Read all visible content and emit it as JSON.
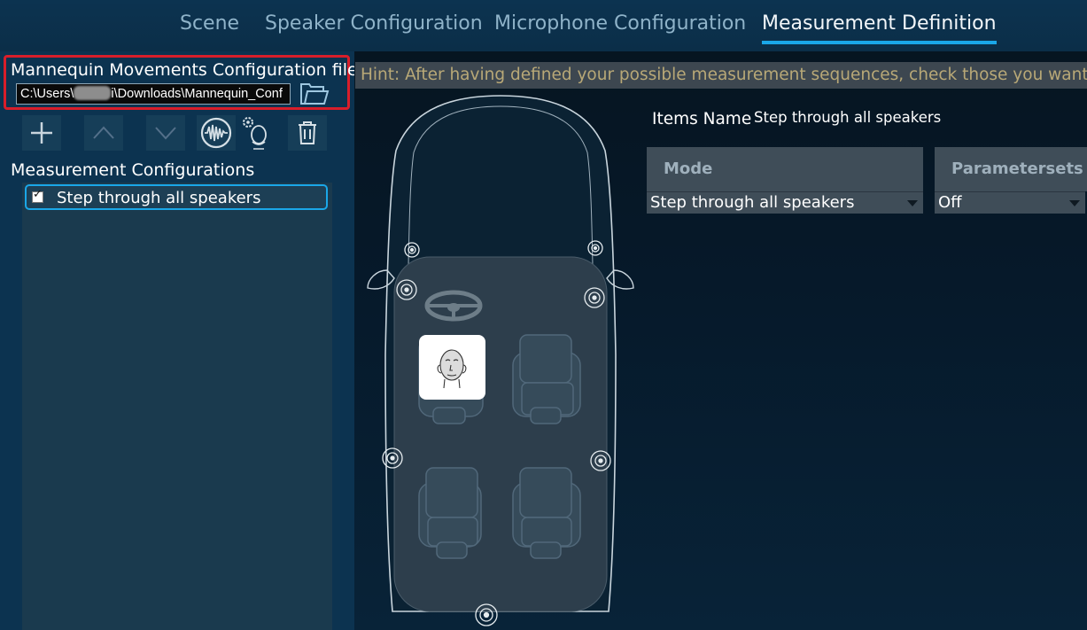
{
  "tabs": [
    {
      "label": "Scene",
      "active": false
    },
    {
      "label": "Speaker Configuration",
      "active": false
    },
    {
      "label": "Microphone Configuration",
      "active": false
    },
    {
      "label": "Measurement Definition",
      "active": true
    }
  ],
  "file": {
    "label": "Mannequin Movements Configuration file :",
    "path_prefix": "C:\\Users\\",
    "path_suffix": "i\\Downloads\\Mannequin_Conf"
  },
  "toolbar": [
    "plus-icon",
    "move-up-icon",
    "move-down-icon",
    "waveform-icon",
    "mannequin-settings-icon",
    "delete-icon"
  ],
  "measurement": {
    "title": "Measurement Configurations",
    "items": [
      {
        "label": "Step through all speakers",
        "checked": true
      }
    ]
  },
  "hint": "Hint: After having defined your possible measurement sequences, check those you want to us",
  "details": {
    "items_name_label": "Items Name",
    "items_name_value": "Step through all speakers",
    "mode_header": "Mode",
    "mode_value": "Step through all speakers",
    "paramsets_header": "Parametersets",
    "paramsets_value": "Off"
  },
  "colors": {
    "accent": "#1aa7e8",
    "highlight_border": "#d81e2a",
    "hint_text": "#b8a877"
  }
}
